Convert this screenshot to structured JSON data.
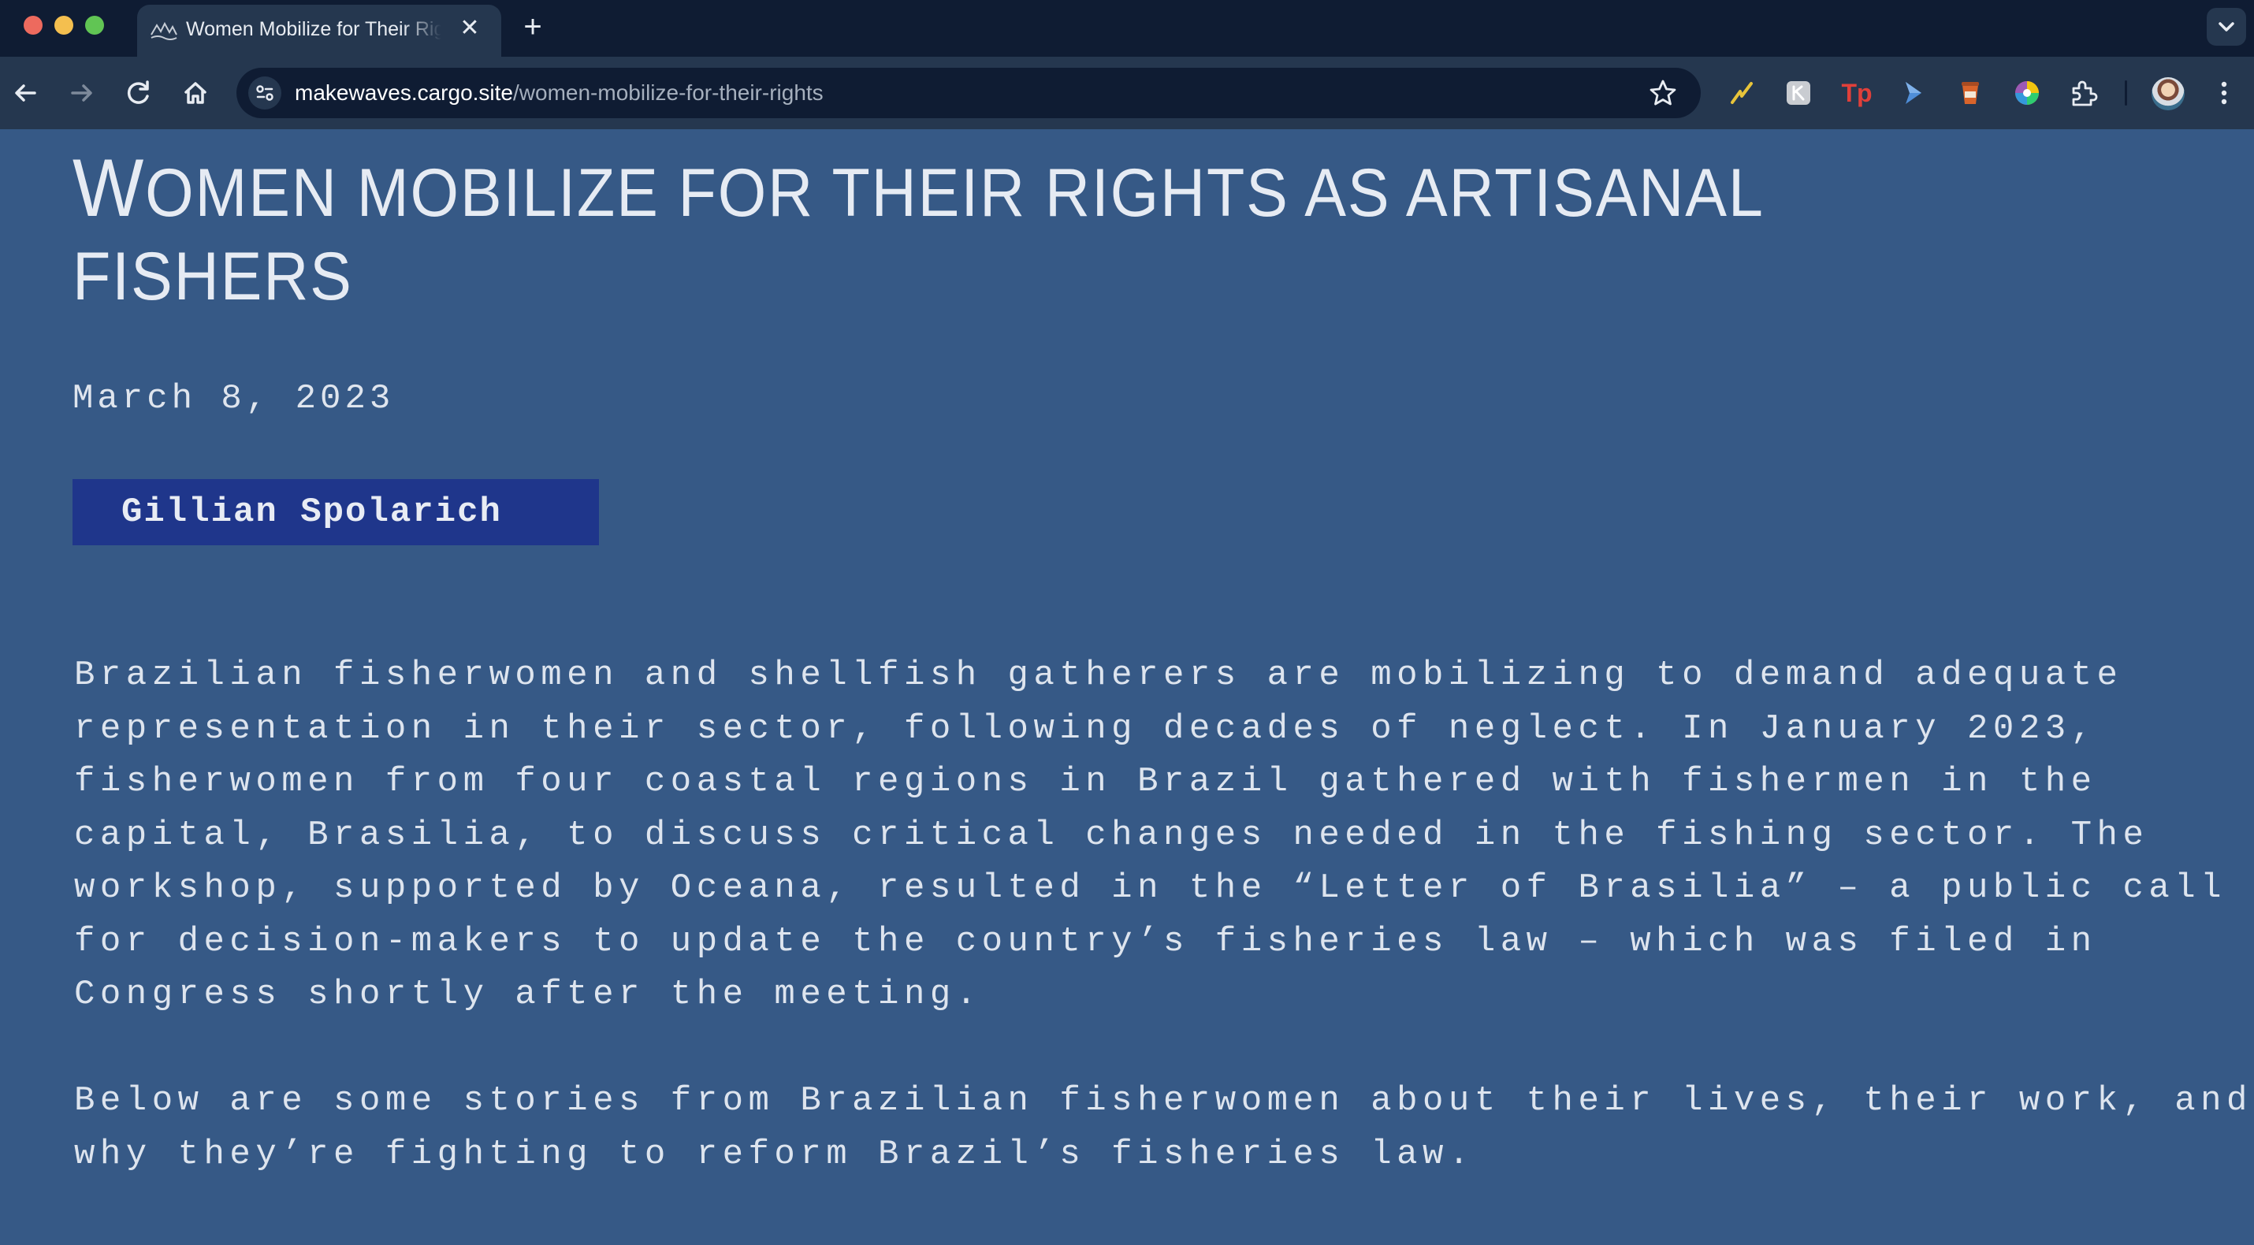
{
  "browser": {
    "tab_title": "Women Mobilize for Their Rights as Artisanal Fishers",
    "tab_close": "✕",
    "new_tab": "+",
    "url_host": "makewaves.cargo.site",
    "url_path": "/women-mobilize-for-their-rights",
    "extensions": [
      "lightning-extension",
      "grey-extension",
      "tp-extension",
      "arrow-extension",
      "cup-extension",
      "color-wheel-extension",
      "puzzle-extensions"
    ],
    "tp_label": "Tp",
    "accent_colors": {
      "chrome_dark": "#0f1c33",
      "chrome_mid": "#25374f",
      "page_bg": "#365986",
      "author_badge": "#1f368b"
    }
  },
  "article": {
    "title_first": "W",
    "title_rest_line1": "omen mobilize for their rights as artisanal",
    "title_line2": "fishers",
    "date": "March 8, 2023",
    "author": "Gillian Spolarich",
    "paragraph1_lines": [
      "Brazilian fisherwomen and shellfish gatherers are mobilizing to demand adequate",
      "representation in their sector, following decades of neglect. In January 2023,",
      "fisherwomen from four coastal regions in Brazil gathered with fishermen in the",
      "capital, Brasilia, to discuss critical changes needed in the fishing sector. The",
      "workshop, supported by Oceana, resulted in the “Letter of Brasilia” – a public call",
      "for decision-makers to update the country’s fisheries law – which was filed in",
      "Congress shortly after the meeting."
    ],
    "paragraph2_lines": [
      "Below are some stories from Brazilian fisherwomen about their lives, their work, and",
      "why they’re fighting to reform Brazil’s fisheries law."
    ]
  }
}
